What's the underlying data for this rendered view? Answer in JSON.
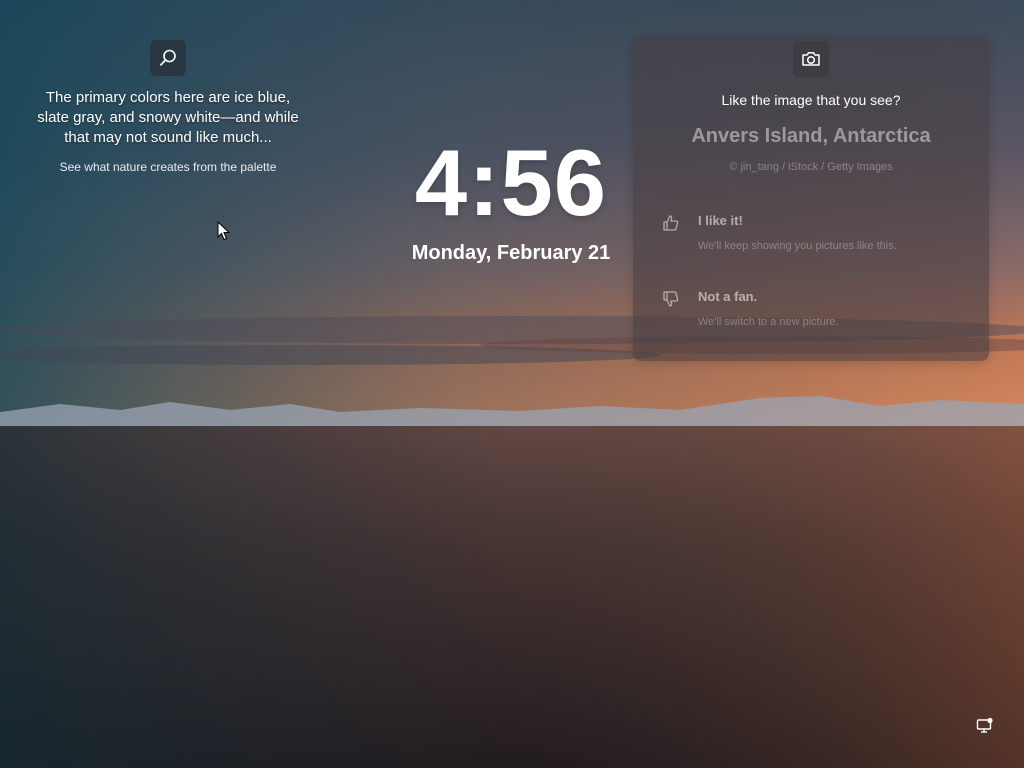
{
  "spotlight": {
    "search_icon": "search-icon",
    "description": "The primary colors here are ice blue, slate gray, and snowy white—and while that may not sound like much...",
    "link": "See what nature creates from the palette"
  },
  "clock": {
    "time": "4:56",
    "date": "Monday, February 21"
  },
  "card": {
    "camera_icon": "camera-icon",
    "prompt": "Like the image that you see?",
    "location": "Anvers Island, Antarctica",
    "credit": "© jin_tang / iStock / Getty Images",
    "like": {
      "icon": "thumbs-up-icon",
      "title": "I like it!",
      "subtitle": "We'll keep showing you pictures like this."
    },
    "dislike": {
      "icon": "thumbs-down-icon",
      "title": "Not a fan.",
      "subtitle": "We'll switch to a new picture."
    }
  },
  "status": {
    "network_icon": "network-icon"
  },
  "colors": {
    "sky_top": "#2c4a5e",
    "sky_mid": "#6a6570",
    "sunset": "#d9774a",
    "water": "#3a2a28"
  }
}
